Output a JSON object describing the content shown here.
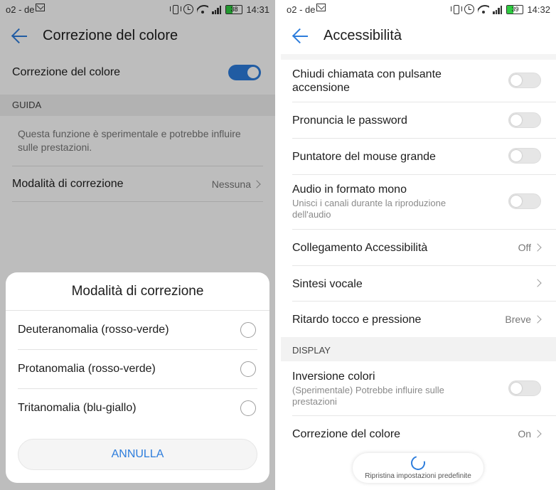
{
  "left": {
    "status": {
      "carrier": "o2 - de",
      "battery": "38",
      "battery_level": 0.38,
      "time": "14:31"
    },
    "title": "Correzione del colore",
    "toggle_row": {
      "label": "Correzione del colore",
      "on": true
    },
    "section": "GUIDA",
    "hint": "Questa funzione è sperimentale e potrebbe influire sulle prestazioni.",
    "mode_row": {
      "label": "Modalità di correzione",
      "value": "Nessuna"
    },
    "dialog": {
      "title": "Modalità di correzione",
      "options": [
        {
          "label": "Deuteranomalia (rosso-verde)"
        },
        {
          "label": "Protanomalia (rosso-verde)"
        },
        {
          "label": "Tritanomalia (blu-giallo)"
        }
      ],
      "cancel": "ANNULLA"
    }
  },
  "right": {
    "status": {
      "carrier": "o2 - de",
      "battery": "39",
      "battery_level": 0.39,
      "time": "14:32"
    },
    "title": "Accessibilità",
    "items": [
      {
        "title": "Chiudi chiamata con pulsante accensione",
        "type": "toggle",
        "on": false
      },
      {
        "title": "Pronuncia le password",
        "type": "toggle",
        "on": false
      },
      {
        "title": "Puntatore del mouse grande",
        "type": "toggle",
        "on": false
      },
      {
        "title": "Audio in formato mono",
        "subtitle": "Unisci i canali durante la riproduzione dell'audio",
        "type": "toggle",
        "on": false
      },
      {
        "title": "Collegamento Accessibilità",
        "value": "Off",
        "type": "nav"
      },
      {
        "title": "Sintesi vocale",
        "type": "nav"
      },
      {
        "title": "Ritardo tocco e pressione",
        "value": "Breve",
        "type": "nav"
      }
    ],
    "section": "DISPLAY",
    "display_items": [
      {
        "title": "Inversione colori",
        "subtitle": "(Sperimentale) Potrebbe influire sulle prestazioni",
        "type": "toggle",
        "on": false
      },
      {
        "title": "Correzione del colore",
        "value": "On",
        "type": "nav"
      }
    ],
    "restore": "Ripristina impostazioni predefinite"
  },
  "colors": {
    "accent": "#2d7ddc",
    "battery_green": "#2ecc40"
  },
  "icons": [
    "mail-icon",
    "vibrate-icon",
    "alarm-icon",
    "wifi-icon",
    "signal-icon",
    "battery-icon",
    "back-arrow-icon",
    "chevron-right-icon",
    "radio-icon",
    "restore-icon"
  ]
}
